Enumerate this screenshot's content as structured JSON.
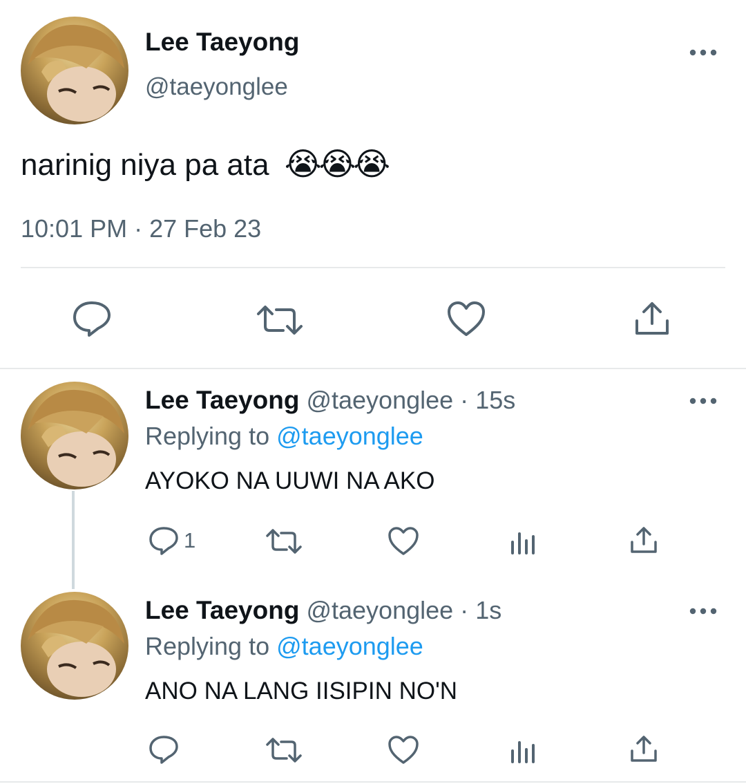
{
  "main_tweet": {
    "display_name": "Lee Taeyong",
    "handle": "@taeyonglee",
    "text": "narinig niya pa ata",
    "emoji": "😭😭😭",
    "timestamp": "10:01 PM · 27 Feb 23",
    "actions": [
      "reply-icon",
      "retweet-icon",
      "like-icon",
      "share-icon"
    ]
  },
  "replies": [
    {
      "display_name": "Lee Taeyong",
      "handle": "@taeyonglee",
      "time": "15s",
      "replying_prefix": "Replying to",
      "replying_handle": "@taeyonglee",
      "text": "AYOKO NA UUWI NA AKO",
      "reply_count": "1"
    },
    {
      "display_name": "Lee Taeyong",
      "handle": "@taeyonglee",
      "time": "1s",
      "replying_prefix": "Replying to",
      "replying_handle": "@taeyonglee",
      "text": "ANO NA LANG IISIPIN NO'N",
      "reply_count": ""
    }
  ],
  "colors": {
    "text": "#0f1419",
    "muted": "#536471",
    "link": "#1d9bf0",
    "divider": "#e7e9ea"
  }
}
